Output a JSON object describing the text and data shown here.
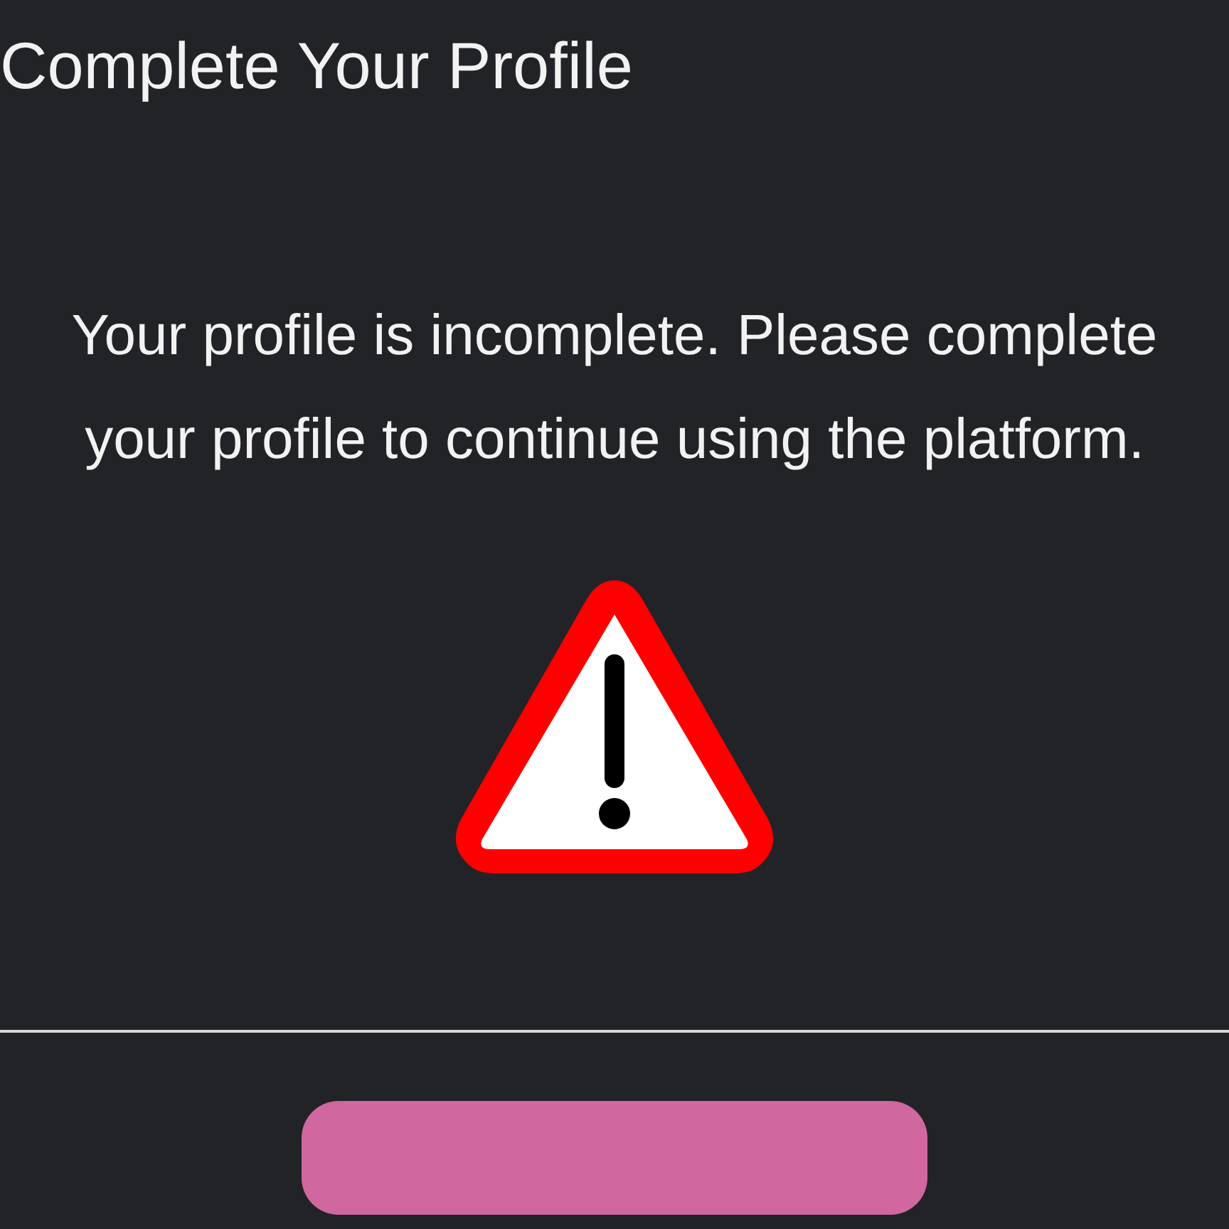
{
  "title": "Complete Your Profile",
  "message": "Your profile is incomplete. Please complete your profile to continue using the platform."
}
